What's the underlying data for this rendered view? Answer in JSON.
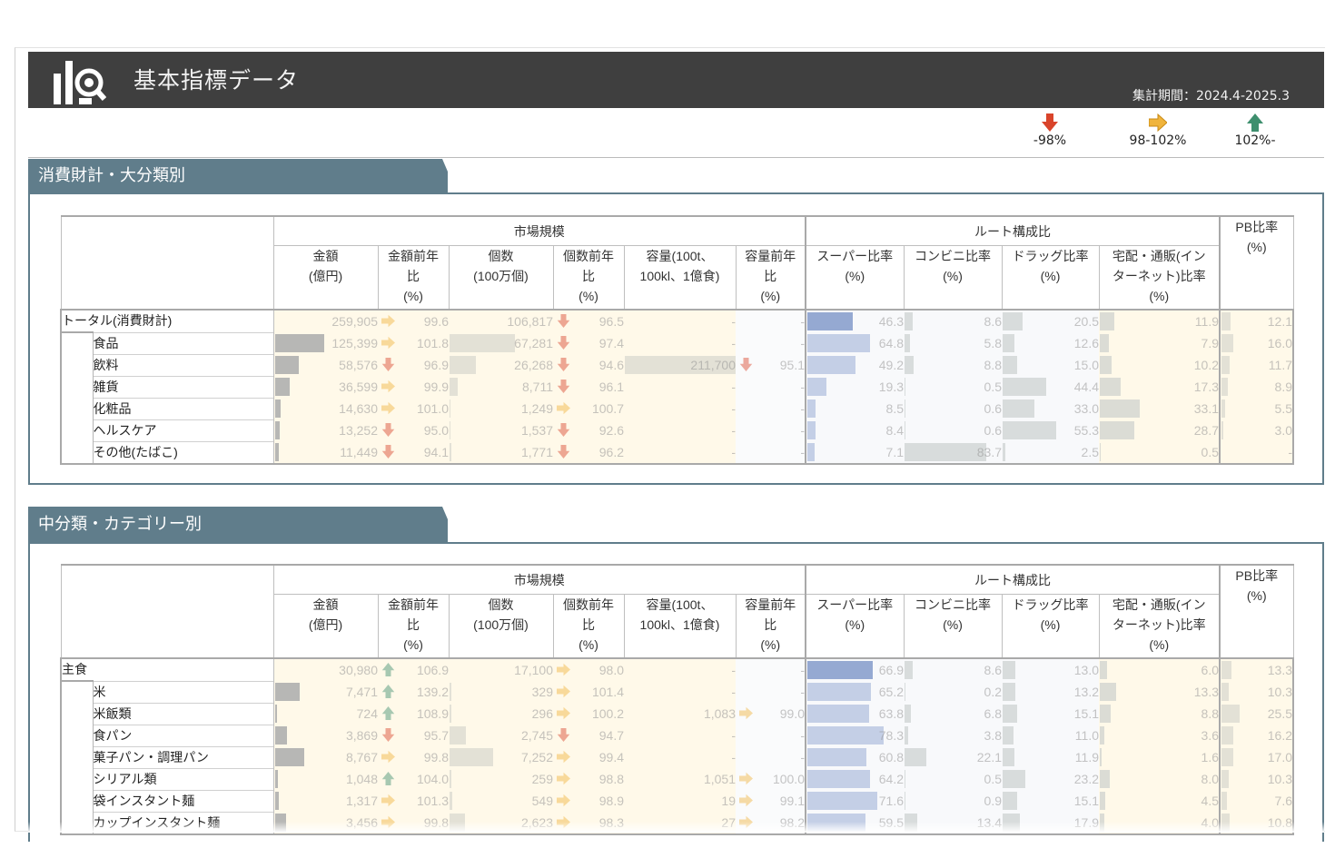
{
  "header": {
    "title": "基本指標データ",
    "period": "集計期間：2024.4-2025.3"
  },
  "legend": [
    {
      "icon": "arrow-down-icon",
      "label": "-98%",
      "color": "#d9442b"
    },
    {
      "icon": "arrow-right-icon",
      "label": "98-102%",
      "color": "#f0b43c"
    },
    {
      "icon": "arrow-up-icon",
      "label": "102%-",
      "color": "#3e8f6e"
    }
  ],
  "columns": {
    "market_group": "市場規模",
    "route_group": "ルート構成比",
    "pb": "PB比率\n(%)",
    "cols": [
      "金額\n(億円)",
      "金額前年\n比\n(%)",
      "個数\n(100万個)",
      "個数前年\n比\n(%)",
      "容量(100t、\n100kl、1億食)",
      "容量前年\n比\n(%)",
      "スーパー比率\n(%)",
      "コンビニ比率\n(%)",
      "ドラッグ比率\n(%)",
      "宅配・通販(イン\nターネット)比率\n(%)"
    ]
  },
  "section1": {
    "title": "消費財計・大分類別",
    "rows": [
      {
        "label": "トータル(消費財計)",
        "total": true,
        "amount": "259,905",
        "amount_yoy": "99.6",
        "amount_arrow": "right",
        "units": "106,817",
        "units_yoy": "96.5",
        "units_arrow": "down",
        "volume": "-",
        "volume_yoy": "-",
        "volume_arrow": "",
        "super": "46.3",
        "cvs": "8.6",
        "drug": "20.5",
        "ec": "11.9",
        "pb": "12.1",
        "amount_share": 0,
        "units_share": 0,
        "volume_share": 0
      },
      {
        "label": "食品",
        "amount": "125,399",
        "amount_yoy": "101.8",
        "amount_arrow": "right",
        "units": "67,281",
        "units_yoy": "97.4",
        "units_arrow": "down",
        "volume": "-",
        "volume_yoy": "-",
        "volume_arrow": "",
        "super": "64.8",
        "cvs": "5.8",
        "drug": "12.6",
        "ec": "7.9",
        "pb": "16.0",
        "amount_share": 0.48,
        "units_share": 0.63,
        "volume_share": 0
      },
      {
        "label": "飲料",
        "amount": "58,576",
        "amount_yoy": "96.9",
        "amount_arrow": "down",
        "units": "26,268",
        "units_yoy": "94.6",
        "units_arrow": "down",
        "volume": "211,700",
        "volume_yoy": "95.1",
        "volume_arrow": "down",
        "super": "49.2",
        "cvs": "8.8",
        "drug": "15.0",
        "ec": "10.2",
        "pb": "11.7",
        "amount_share": 0.23,
        "units_share": 0.25,
        "volume_share": 1.0
      },
      {
        "label": "雑貨",
        "amount": "36,599",
        "amount_yoy": "99.9",
        "amount_arrow": "right",
        "units": "8,711",
        "units_yoy": "96.1",
        "units_arrow": "down",
        "volume": "-",
        "volume_yoy": "-",
        "volume_arrow": "",
        "super": "19.3",
        "cvs": "0.5",
        "drug": "44.4",
        "ec": "17.3",
        "pb": "8.9",
        "amount_share": 0.14,
        "units_share": 0.08,
        "volume_share": 0
      },
      {
        "label": "化粧品",
        "amount": "14,630",
        "amount_yoy": "101.0",
        "amount_arrow": "right",
        "units": "1,249",
        "units_yoy": "100.7",
        "units_arrow": "right",
        "volume": "-",
        "volume_yoy": "-",
        "volume_arrow": "",
        "super": "8.5",
        "cvs": "0.6",
        "drug": "33.0",
        "ec": "33.1",
        "pb": "5.5",
        "amount_share": 0.06,
        "units_share": 0.01,
        "volume_share": 0
      },
      {
        "label": "ヘルスケア",
        "amount": "13,252",
        "amount_yoy": "95.0",
        "amount_arrow": "down",
        "units": "1,537",
        "units_yoy": "92.6",
        "units_arrow": "down",
        "volume": "-",
        "volume_yoy": "-",
        "volume_arrow": "",
        "super": "8.4",
        "cvs": "0.6",
        "drug": "55.3",
        "ec": "28.7",
        "pb": "3.0",
        "amount_share": 0.05,
        "units_share": 0.01,
        "volume_share": 0
      },
      {
        "label": "その他(たばこ)",
        "amount": "11,449",
        "amount_yoy": "94.1",
        "amount_arrow": "down",
        "units": "1,771",
        "units_yoy": "96.2",
        "units_arrow": "down",
        "volume": "-",
        "volume_yoy": "-",
        "volume_arrow": "",
        "super": "7.1",
        "cvs": "83.7",
        "drug": "2.5",
        "ec": "0.5",
        "pb": "-",
        "amount_share": 0.04,
        "units_share": 0.02,
        "volume_share": 0
      }
    ]
  },
  "section2": {
    "title": "中分類・カテゴリー別",
    "rows": [
      {
        "label": "主食",
        "total": true,
        "amount": "30,980",
        "amount_yoy": "106.9",
        "amount_arrow": "up",
        "units": "17,100",
        "units_yoy": "98.0",
        "units_arrow": "right",
        "volume": "-",
        "volume_yoy": "-",
        "volume_arrow": "",
        "super": "66.9",
        "cvs": "8.6",
        "drug": "13.0",
        "ec": "6.0",
        "pb": "13.3",
        "amount_share": 0,
        "units_share": 0,
        "volume_share": 0
      },
      {
        "label": "米",
        "amount": "7,471",
        "amount_yoy": "139.2",
        "amount_arrow": "up",
        "units": "329",
        "units_yoy": "101.4",
        "units_arrow": "right",
        "volume": "-",
        "volume_yoy": "-",
        "volume_arrow": "",
        "super": "65.2",
        "cvs": "0.2",
        "drug": "13.2",
        "ec": "13.3",
        "pb": "10.3",
        "amount_share": 0.24,
        "units_share": 0.02,
        "volume_share": 0
      },
      {
        "label": "米飯類",
        "amount": "724",
        "amount_yoy": "108.9",
        "amount_arrow": "up",
        "units": "296",
        "units_yoy": "100.2",
        "units_arrow": "right",
        "volume": "1,083",
        "volume_yoy": "99.0",
        "volume_arrow": "right",
        "super": "63.8",
        "cvs": "6.8",
        "drug": "15.1",
        "ec": "8.8",
        "pb": "25.5",
        "amount_share": 0.02,
        "units_share": 0.02,
        "volume_share": 0
      },
      {
        "label": "食パン",
        "amount": "3,869",
        "amount_yoy": "95.7",
        "amount_arrow": "down",
        "units": "2,745",
        "units_yoy": "94.7",
        "units_arrow": "down",
        "volume": "-",
        "volume_yoy": "-",
        "volume_arrow": "",
        "super": "78.3",
        "cvs": "3.8",
        "drug": "11.0",
        "ec": "3.6",
        "pb": "16.2",
        "amount_share": 0.12,
        "units_share": 0.16,
        "volume_share": 0
      },
      {
        "label": "菓子パン・調理パン",
        "amount": "8,767",
        "amount_yoy": "99.8",
        "amount_arrow": "right",
        "units": "7,252",
        "units_yoy": "99.4",
        "units_arrow": "right",
        "volume": "-",
        "volume_yoy": "-",
        "volume_arrow": "",
        "super": "60.8",
        "cvs": "22.1",
        "drug": "11.9",
        "ec": "1.6",
        "pb": "17.0",
        "amount_share": 0.28,
        "units_share": 0.42,
        "volume_share": 0
      },
      {
        "label": "シリアル類",
        "amount": "1,048",
        "amount_yoy": "104.0",
        "amount_arrow": "up",
        "units": "259",
        "units_yoy": "98.8",
        "units_arrow": "right",
        "volume": "1,051",
        "volume_yoy": "100.0",
        "volume_arrow": "right",
        "super": "64.2",
        "cvs": "0.5",
        "drug": "23.2",
        "ec": "8.0",
        "pb": "10.3",
        "amount_share": 0.03,
        "units_share": 0.02,
        "volume_share": 0
      },
      {
        "label": "袋インスタント麺",
        "amount": "1,317",
        "amount_yoy": "101.3",
        "amount_arrow": "right",
        "units": "549",
        "units_yoy": "98.9",
        "units_arrow": "right",
        "volume": "19",
        "volume_yoy": "99.1",
        "volume_arrow": "right",
        "super": "71.6",
        "cvs": "0.9",
        "drug": "15.1",
        "ec": "4.5",
        "pb": "7.6",
        "amount_share": 0.04,
        "units_share": 0.03,
        "volume_share": 0
      },
      {
        "label": "カップインスタント麺",
        "amount": "3,456",
        "amount_yoy": "99.8",
        "amount_arrow": "right",
        "units": "2,623",
        "units_yoy": "98.3",
        "units_arrow": "right",
        "volume": "27",
        "volume_yoy": "98.2",
        "volume_arrow": "right",
        "super": "59.5",
        "cvs": "13.4",
        "drug": "17.9",
        "ec": "4.0",
        "pb": "10.8",
        "amount_share": 0.11,
        "units_share": 0.15,
        "volume_share": 0
      }
    ]
  }
}
